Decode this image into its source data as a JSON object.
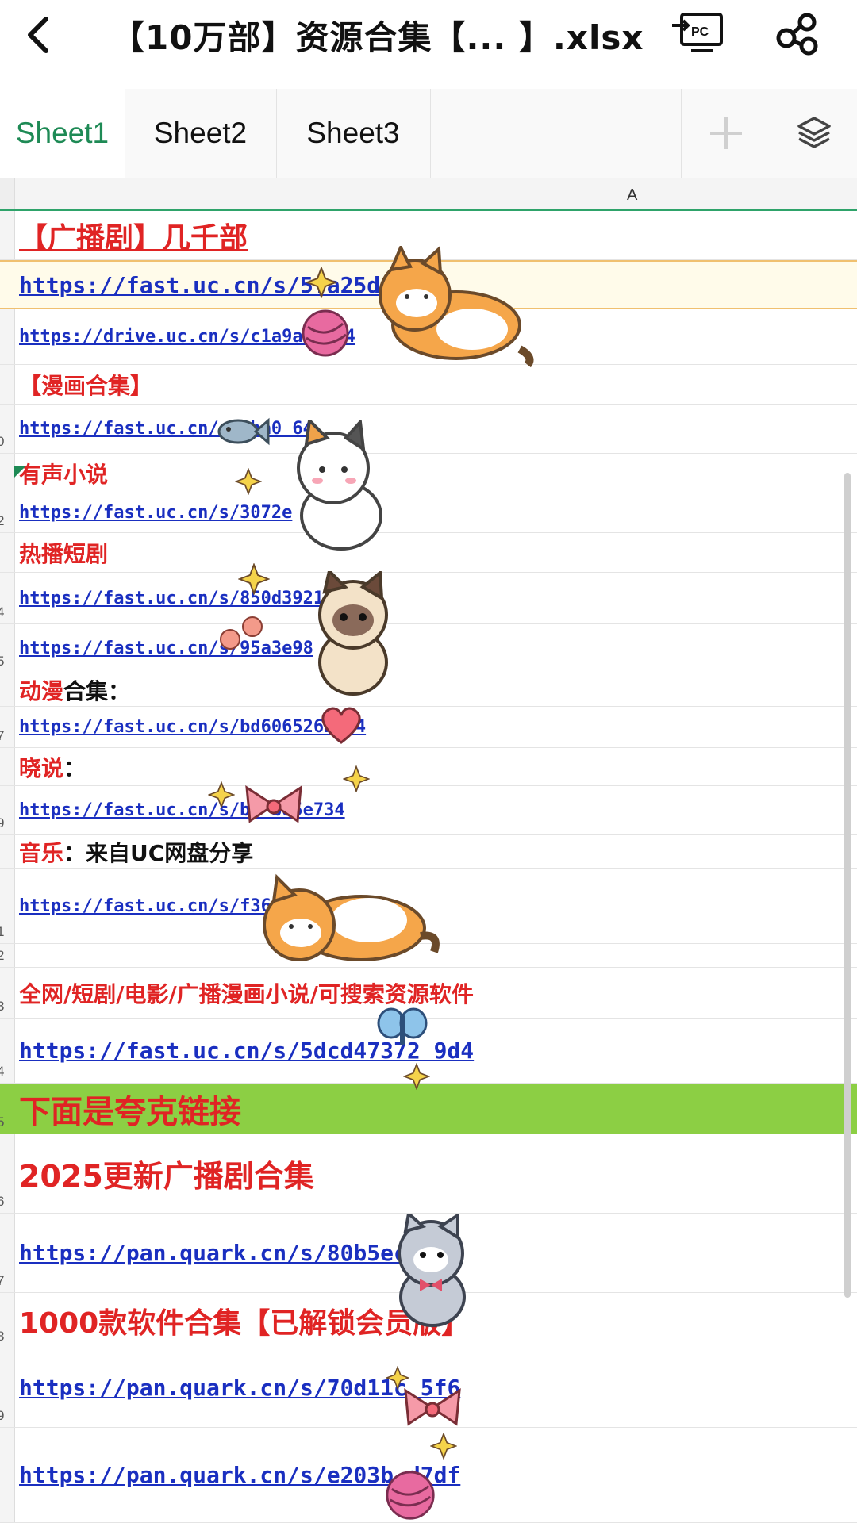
{
  "header": {
    "back_icon": "chevron-left-icon",
    "title": "【10万部】资源合集【...  】.xlsx",
    "pc_label": "PC",
    "share_icon": "share-icon"
  },
  "tabs": [
    {
      "label": "Sheet1",
      "active": true
    },
    {
      "label": "Sheet2",
      "active": false
    },
    {
      "label": "Sheet3",
      "active": false
    }
  ],
  "add_sheet_icon": "plus-icon",
  "layers_icon": "layers-icon",
  "column_header": "A",
  "rows": [
    {
      "num": "",
      "parts": [
        {
          "text": "【广播剧】几千部",
          "style": "red"
        }
      ]
    },
    {
      "num": "",
      "parts": [
        {
          "text": "https://fast.uc.cn/s/5fa25d",
          "style": "link"
        }
      ]
    },
    {
      "num": "",
      "parts": [
        {
          "text": "https://drive.uc.cn/s/c1a9ad   a24",
          "style": "link"
        }
      ]
    },
    {
      "num": "",
      "parts": [
        {
          "text": "【漫画合集】",
          "style": "red"
        }
      ]
    },
    {
      "num": "0",
      "parts": [
        {
          "text": "https://fast.uc.cn/s/   ba0   64",
          "style": "link"
        }
      ]
    },
    {
      "num": "",
      "parts": [
        {
          "text": "有声小说",
          "style": "red"
        }
      ]
    },
    {
      "num": "2",
      "parts": [
        {
          "text": "https://fast.uc.cn/s/3072e",
          "style": "link"
        }
      ]
    },
    {
      "num": "",
      "parts": [
        {
          "text": "热播短剧",
          "style": "red"
        }
      ]
    },
    {
      "num": "4",
      "parts": [
        {
          "text": "https://fast.uc.cn/s/850d3921",
          "style": "link"
        }
      ]
    },
    {
      "num": "5",
      "parts": [
        {
          "text": "https://fast.uc.cn/s/95a3e98",
          "style": "link"
        }
      ]
    },
    {
      "num": "",
      "parts": [
        {
          "text": "动漫",
          "style": "red"
        },
        {
          "text": "合集：",
          "style": "black"
        }
      ]
    },
    {
      "num": "7",
      "parts": [
        {
          "text": "https://fast.uc.cn/s/bd606526b  d4",
          "style": "link"
        }
      ]
    },
    {
      "num": "",
      "parts": [
        {
          "text": "晓说",
          "style": "red"
        },
        {
          "text": "：",
          "style": "black"
        }
      ]
    },
    {
      "num": "9",
      "parts": [
        {
          "text": "https://fast.uc.cn/s/b2   b85e734",
          "style": "link"
        }
      ]
    },
    {
      "num": "",
      "parts": [
        {
          "text": "音乐",
          "style": "red"
        },
        {
          "text": "：来自UC网盘分享",
          "style": "black"
        }
      ]
    },
    {
      "num": "1",
      "parts": [
        {
          "text": "https://fast.uc.cn/s/f36",
          "style": "link"
        }
      ]
    },
    {
      "num": "2",
      "parts": []
    },
    {
      "num": "3",
      "parts": [
        {
          "text": "全网/短剧/电影/广播漫画小说/可搜索资源软件",
          "style": "red"
        }
      ]
    },
    {
      "num": "4",
      "parts": [
        {
          "text": "https://fast.uc.cn/s/5dcd47372 9d4",
          "style": "link"
        }
      ]
    },
    {
      "num": "5",
      "parts": [
        {
          "text": "下面是夸克链接",
          "style": "red"
        }
      ]
    },
    {
      "num": "6",
      "parts": [
        {
          "text": "2025更新广播剧合集",
          "style": "red"
        }
      ]
    },
    {
      "num": "7",
      "parts": [
        {
          "text": "https://pan.quark.cn/s/80b5ec   b3",
          "style": "link"
        }
      ]
    },
    {
      "num": "8",
      "parts": [
        {
          "text": "1000款软件合集【已解锁会员版】",
          "style": "red"
        }
      ]
    },
    {
      "num": "9",
      "parts": [
        {
          "text": "https://pan.quark.cn/s/70d11c   5f6",
          "style": "link"
        }
      ]
    },
    {
      "num": "",
      "parts": [
        {
          "text": "https://pan.quark.cn/s/e203b   d7df",
          "style": "link"
        }
      ]
    }
  ],
  "colors": {
    "accent": "#1e8a55",
    "red_text": "#e02424",
    "link": "#1a2fc0",
    "green_fill": "#8ccf44"
  },
  "stickers": [
    "cat-sticker",
    "yarn-ball-sticker",
    "fish-sticker",
    "sparkle-sticker",
    "flower-sticker",
    "heart-sticker",
    "bow-sticker",
    "butterfly-sticker"
  ]
}
